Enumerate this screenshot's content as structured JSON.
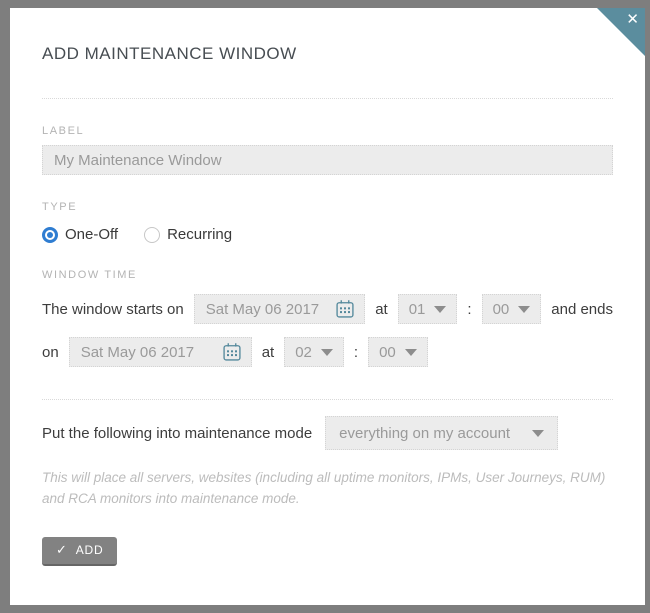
{
  "modal": {
    "title": "ADD MAINTENANCE WINDOW",
    "close_glyph": "✕"
  },
  "label_section": {
    "label": "LABEL",
    "placeholder": "My Maintenance Window"
  },
  "type_section": {
    "label": "TYPE",
    "options": [
      {
        "label": "One-Off",
        "selected": true
      },
      {
        "label": "Recurring",
        "selected": false
      }
    ]
  },
  "window_time": {
    "label": "WINDOW TIME",
    "starts_text": "The window starts on",
    "start_date": "Sat May 06 2017",
    "at_text": "at",
    "start_hour": "01",
    "colon": ":",
    "start_minute": "00",
    "ends_text": "and ends",
    "on_text": "on",
    "end_date": "Sat May 06 2017",
    "end_hour": "02",
    "end_minute": "00"
  },
  "scope_section": {
    "prompt": "Put the following into maintenance mode",
    "selected_option": "everything on my account"
  },
  "note": "This will place all servers, websites (including all uptime monitors, IPMs, User Journeys, RUM) and RCA monitors into maintenance mode.",
  "actions": {
    "check_glyph": "✓",
    "add_label": "ADD"
  },
  "colors": {
    "accent_teal": "#5b8d9e",
    "radio_blue": "#2f7dd1",
    "button_gray": "#828282",
    "field_bg": "#ececec",
    "backdrop": "#7e7e7e"
  }
}
